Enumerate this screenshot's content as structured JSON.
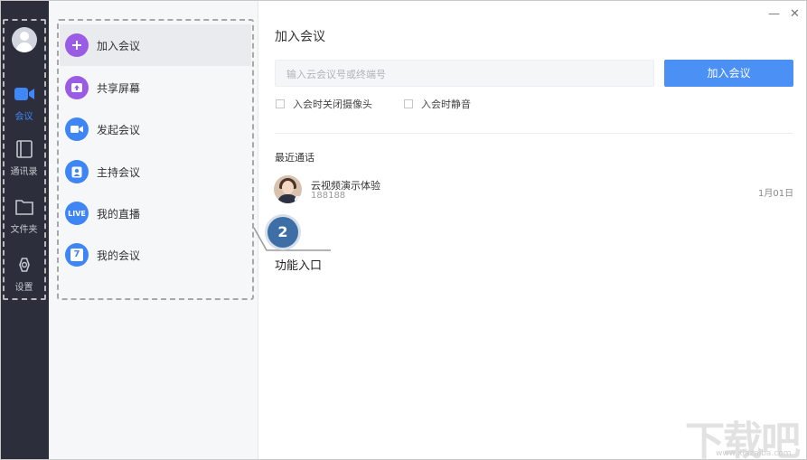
{
  "window": {
    "minimize_label": "—",
    "close_label": "✕"
  },
  "rail": {
    "items": [
      {
        "label": "会议",
        "icon": "video-icon",
        "active": true
      },
      {
        "label": "通讯录",
        "icon": "contacts-icon",
        "active": false
      },
      {
        "label": "文件夹",
        "icon": "folder-icon",
        "active": false
      },
      {
        "label": "设置",
        "icon": "settings-icon",
        "active": false
      }
    ],
    "active_color": "#3f86f7"
  },
  "menu": {
    "items": [
      {
        "label": "加入会议",
        "icon": "plus-icon",
        "color": "#9a5be5"
      },
      {
        "label": "共享屏幕",
        "icon": "share-screen-icon",
        "color": "#9a5be5"
      },
      {
        "label": "发起会议",
        "icon": "video-camera-icon",
        "color": "#3e86f5"
      },
      {
        "label": "主持会议",
        "icon": "host-icon",
        "color": "#3e86f5"
      },
      {
        "label": "我的直播",
        "icon": "live-icon",
        "icon_text": "LIVE",
        "color": "#3e86f5"
      },
      {
        "label": "我的会议",
        "icon": "calendar-icon",
        "icon_text": "7",
        "color": "#3e86f5"
      }
    ]
  },
  "main": {
    "title": "加入会议",
    "input_placeholder": "输入云会议号或终端号",
    "join_button": "加入会议",
    "options": [
      "入会时关闭摄像头",
      "入会时静音"
    ],
    "recent_title": "最近通话",
    "recent": [
      {
        "name": "云视频演示体验",
        "id": "188188",
        "date": "1月01日"
      }
    ]
  },
  "annotation": {
    "number": "2",
    "label": "功能入口"
  },
  "watermark": {
    "text": "下载吧",
    "url": "www.xiazaiba.com"
  }
}
